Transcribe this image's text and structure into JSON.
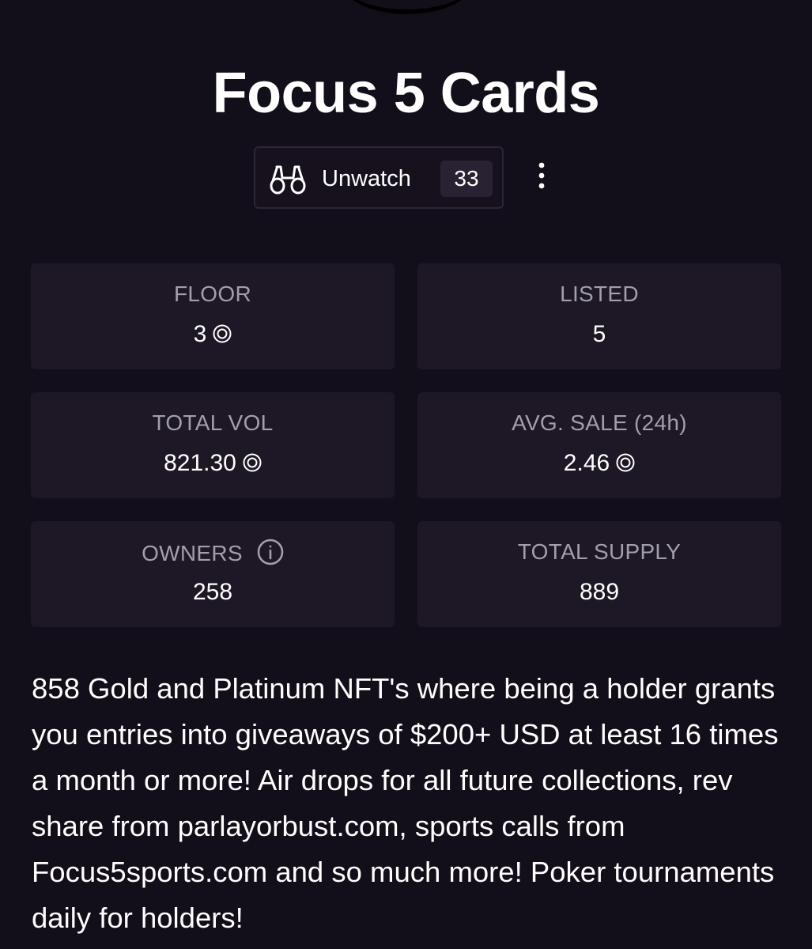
{
  "collection": {
    "title": "Focus 5 Cards"
  },
  "watch": {
    "label": "Unwatch",
    "count": "33"
  },
  "stats": {
    "floor": {
      "label": "FLOOR",
      "value": "3"
    },
    "listed": {
      "label": "LISTED",
      "value": "5"
    },
    "total_vol": {
      "label": "TOTAL VOL",
      "value": "821.30"
    },
    "avg_sale": {
      "label": "AVG. SALE (24h)",
      "value": "2.46"
    },
    "owners": {
      "label": "OWNERS",
      "value": "258"
    },
    "total_supply": {
      "label": "TOTAL SUPPLY",
      "value": "889"
    }
  },
  "description": "858 Gold and Platinum NFT's where being a holder grants you entries into giveaways of $200+ USD at least 16 times a month or more! Air drops for all future collections, rev share from parlayorbust.com, sports calls from Focus5sports.com and so much more! Poker tournaments daily for holders!",
  "icons": {
    "watch": "binoculars-icon",
    "more": "more-vertical-icon",
    "currency": "sol-currency-icon",
    "info": "info-icon"
  },
  "colors": {
    "background": "#130f1a",
    "card": "#1e1826",
    "label": "#a39eab",
    "text": "#ffffff"
  }
}
